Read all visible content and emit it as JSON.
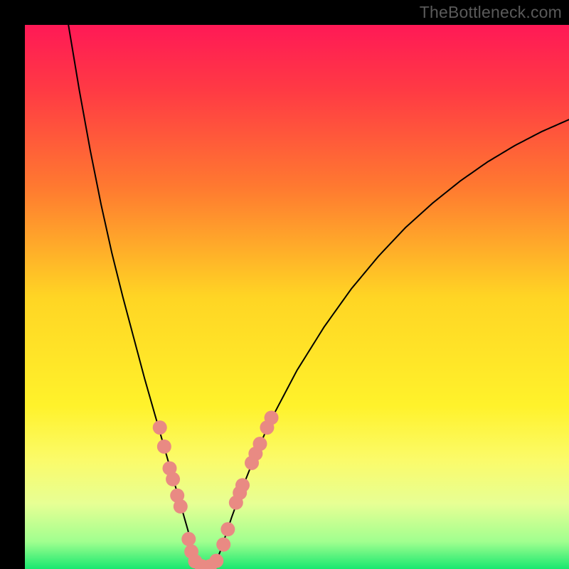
{
  "watermark": "TheBottleneck.com",
  "chart_data": {
    "type": "line",
    "title": "",
    "xlabel": "",
    "ylabel": "",
    "xlim": [
      0,
      100
    ],
    "ylim": [
      0,
      100
    ],
    "background_gradient": {
      "stops": [
        {
          "offset": 0.0,
          "color": "#ff1956"
        },
        {
          "offset": 0.12,
          "color": "#ff3a44"
        },
        {
          "offset": 0.3,
          "color": "#ff7a30"
        },
        {
          "offset": 0.5,
          "color": "#ffd524"
        },
        {
          "offset": 0.7,
          "color": "#fff22b"
        },
        {
          "offset": 0.8,
          "color": "#fbfb6a"
        },
        {
          "offset": 0.88,
          "color": "#e7ff94"
        },
        {
          "offset": 0.95,
          "color": "#a0ff8f"
        },
        {
          "offset": 1.0,
          "color": "#18e86f"
        }
      ]
    },
    "series": [
      {
        "name": "left-branch",
        "stroke": "#000000",
        "stroke_width": 2,
        "x": [
          8.0,
          9.0,
          10.0,
          12.0,
          14.0,
          16.0,
          18.0,
          20.0,
          22.0,
          24.0,
          25.0,
          26.0,
          27.0,
          28.0,
          29.0,
          30.0,
          30.5,
          31.0
        ],
        "y": [
          100.0,
          94.0,
          88.0,
          77.0,
          67.0,
          58.0,
          50.0,
          42.5,
          35.0,
          28.0,
          24.5,
          21.0,
          17.5,
          14.0,
          10.5,
          7.0,
          4.0,
          1.0
        ]
      },
      {
        "name": "valley-floor",
        "stroke": "#000000",
        "stroke_width": 2,
        "x": [
          31.0,
          32.0,
          33.0,
          34.0,
          35.0
        ],
        "y": [
          1.0,
          0.3,
          0.1,
          0.3,
          1.0
        ]
      },
      {
        "name": "right-branch",
        "stroke": "#000000",
        "stroke_width": 2,
        "x": [
          35.0,
          36.0,
          37.0,
          38.0,
          40.0,
          42.0,
          45.0,
          50.0,
          55.0,
          60.0,
          65.0,
          70.0,
          75.0,
          80.0,
          85.0,
          90.0,
          95.0,
          100.0
        ],
        "y": [
          1.0,
          3.5,
          6.5,
          9.5,
          15.0,
          20.0,
          27.0,
          36.5,
          44.5,
          51.5,
          57.5,
          62.8,
          67.3,
          71.3,
          74.8,
          77.8,
          80.4,
          82.6
        ]
      }
    ],
    "highlight_markers": {
      "color": "#e98a83",
      "radius": 10,
      "points": [
        {
          "x": 24.8,
          "y": 26.0
        },
        {
          "x": 25.6,
          "y": 22.5
        },
        {
          "x": 26.6,
          "y": 18.5
        },
        {
          "x": 27.2,
          "y": 16.5
        },
        {
          "x": 28.0,
          "y": 13.5
        },
        {
          "x": 28.6,
          "y": 11.5
        },
        {
          "x": 30.1,
          "y": 5.5
        },
        {
          "x": 30.6,
          "y": 3.2
        },
        {
          "x": 31.3,
          "y": 1.4
        },
        {
          "x": 32.5,
          "y": 0.5
        },
        {
          "x": 34.0,
          "y": 0.5
        },
        {
          "x": 35.2,
          "y": 1.5
        },
        {
          "x": 36.5,
          "y": 4.5
        },
        {
          "x": 37.3,
          "y": 7.3
        },
        {
          "x": 38.8,
          "y": 12.2
        },
        {
          "x": 39.5,
          "y": 14.0
        },
        {
          "x": 40.0,
          "y": 15.4
        },
        {
          "x": 41.7,
          "y": 19.5
        },
        {
          "x": 42.4,
          "y": 21.2
        },
        {
          "x": 43.2,
          "y": 23.0
        },
        {
          "x": 44.5,
          "y": 26.0
        },
        {
          "x": 45.3,
          "y": 27.8
        }
      ]
    }
  }
}
